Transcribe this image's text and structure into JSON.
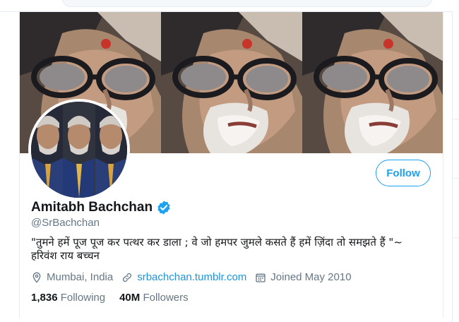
{
  "profile": {
    "display_name": "Amitabh Bachchan",
    "handle": "@SrBachchan",
    "bio": "\"तुमने हमें पूज पूज कर पत्थर कर डाला ; वे जो हमपर जुमले कसते हैं हमें ज़िंदा तो समझते हैं \"~ हरिवंश राय  बच्चन",
    "location": "Mumbai, India",
    "website": "srbachchan.tumblr.com",
    "joined": "Joined May 2010",
    "verified": true,
    "follow_label": "Follow"
  },
  "stats": {
    "following_count": "1,836",
    "following_label": "Following",
    "followers_count": "40M",
    "followers_label": "Followers"
  },
  "icons": {
    "location": "location-pin-icon",
    "link": "link-icon",
    "calendar": "calendar-icon",
    "verified": "verified-badge-icon"
  },
  "colors": {
    "accent": "#1da1f2",
    "link": "#1b95e0",
    "muted": "#657786",
    "text": "#14171a"
  }
}
